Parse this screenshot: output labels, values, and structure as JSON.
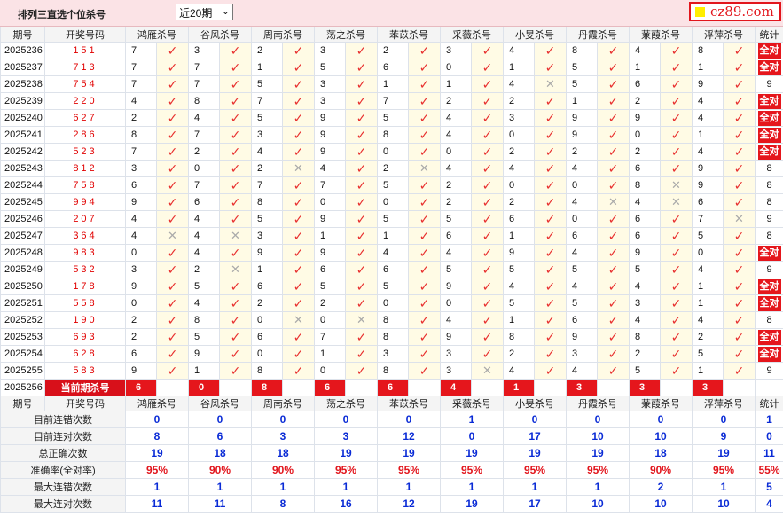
{
  "header": {
    "title": "排列三直选个位杀号",
    "period_select": "近20期",
    "logo_text": "cz89.com"
  },
  "columns": {
    "issue": "期号",
    "draw": "开奖号码",
    "stat": "统计",
    "predictors": [
      "鸿雁杀号",
      "谷风杀号",
      "周南杀号",
      "荡之杀号",
      "苯苡杀号",
      "采薇杀号",
      "小旻杀号",
      "丹霞杀号",
      "蒹葭杀号",
      "浮萍杀号"
    ]
  },
  "full_badge": "全对",
  "rows": [
    {
      "issue": "2025236",
      "draw": "151",
      "kills": [
        7,
        3,
        2,
        3,
        2,
        3,
        4,
        8,
        4,
        8
      ],
      "hits": [
        1,
        1,
        1,
        1,
        1,
        1,
        1,
        1,
        1,
        1
      ],
      "stat": "全对"
    },
    {
      "issue": "2025237",
      "draw": "713",
      "kills": [
        7,
        7,
        1,
        5,
        6,
        0,
        1,
        5,
        1,
        1
      ],
      "hits": [
        1,
        1,
        1,
        1,
        1,
        1,
        1,
        1,
        1,
        1
      ],
      "stat": "全对"
    },
    {
      "issue": "2025238",
      "draw": "754",
      "kills": [
        7,
        7,
        5,
        3,
        1,
        1,
        4,
        5,
        6,
        9
      ],
      "hits": [
        1,
        1,
        1,
        1,
        1,
        1,
        0,
        1,
        1,
        1
      ],
      "stat": "9"
    },
    {
      "issue": "2025239",
      "draw": "220",
      "kills": [
        4,
        8,
        7,
        3,
        7,
        2,
        2,
        1,
        2,
        4
      ],
      "hits": [
        1,
        1,
        1,
        1,
        1,
        1,
        1,
        1,
        1,
        1
      ],
      "stat": "全对"
    },
    {
      "issue": "2025240",
      "draw": "627",
      "kills": [
        2,
        4,
        5,
        9,
        5,
        4,
        3,
        9,
        9,
        4
      ],
      "hits": [
        1,
        1,
        1,
        1,
        1,
        1,
        1,
        1,
        1,
        1
      ],
      "stat": "全对"
    },
    {
      "issue": "2025241",
      "draw": "286",
      "kills": [
        8,
        7,
        3,
        9,
        8,
        4,
        0,
        9,
        0,
        1
      ],
      "hits": [
        1,
        1,
        1,
        1,
        1,
        1,
        1,
        1,
        1,
        1
      ],
      "stat": "全对"
    },
    {
      "issue": "2025242",
      "draw": "523",
      "kills": [
        7,
        2,
        4,
        9,
        0,
        0,
        2,
        2,
        2,
        4
      ],
      "hits": [
        1,
        1,
        1,
        1,
        1,
        1,
        1,
        1,
        1,
        1
      ],
      "stat": "全对"
    },
    {
      "issue": "2025243",
      "draw": "812",
      "kills": [
        3,
        0,
        2,
        4,
        2,
        4,
        4,
        4,
        6,
        9
      ],
      "hits": [
        1,
        1,
        0,
        1,
        0,
        1,
        1,
        1,
        1,
        1
      ],
      "stat": "8"
    },
    {
      "issue": "2025244",
      "draw": "758",
      "kills": [
        6,
        7,
        7,
        7,
        5,
        2,
        0,
        0,
        8,
        9
      ],
      "hits": [
        1,
        1,
        1,
        1,
        1,
        1,
        1,
        1,
        0,
        1
      ],
      "stat": "8"
    },
    {
      "issue": "2025245",
      "draw": "994",
      "kills": [
        9,
        6,
        8,
        0,
        0,
        2,
        2,
        4,
        4,
        6
      ],
      "hits": [
        1,
        1,
        1,
        1,
        1,
        1,
        1,
        0,
        0,
        1
      ],
      "stat": "8"
    },
    {
      "issue": "2025246",
      "draw": "207",
      "kills": [
        4,
        4,
        5,
        9,
        5,
        5,
        6,
        0,
        6,
        7
      ],
      "hits": [
        1,
        1,
        1,
        1,
        1,
        1,
        1,
        1,
        1,
        0
      ],
      "stat": "9"
    },
    {
      "issue": "2025247",
      "draw": "364",
      "kills": [
        4,
        4,
        3,
        1,
        1,
        6,
        1,
        6,
        6,
        5
      ],
      "hits": [
        0,
        0,
        1,
        1,
        1,
        1,
        1,
        1,
        1,
        1
      ],
      "stat": "8"
    },
    {
      "issue": "2025248",
      "draw": "983",
      "kills": [
        0,
        4,
        9,
        9,
        4,
        4,
        9,
        4,
        9,
        0
      ],
      "hits": [
        1,
        1,
        1,
        1,
        1,
        1,
        1,
        1,
        1,
        1
      ],
      "stat": "全对"
    },
    {
      "issue": "2025249",
      "draw": "532",
      "kills": [
        3,
        2,
        1,
        6,
        6,
        5,
        5,
        5,
        5,
        4
      ],
      "hits": [
        1,
        0,
        1,
        1,
        1,
        1,
        1,
        1,
        1,
        1
      ],
      "stat": "9"
    },
    {
      "issue": "2025250",
      "draw": "178",
      "kills": [
        9,
        5,
        6,
        5,
        5,
        9,
        4,
        4,
        4,
        1
      ],
      "hits": [
        1,
        1,
        1,
        1,
        1,
        1,
        1,
        1,
        1,
        1
      ],
      "stat": "全对"
    },
    {
      "issue": "2025251",
      "draw": "558",
      "kills": [
        0,
        4,
        2,
        2,
        0,
        0,
        5,
        5,
        3,
        1
      ],
      "hits": [
        1,
        1,
        1,
        1,
        1,
        1,
        1,
        1,
        1,
        1
      ],
      "stat": "全对"
    },
    {
      "issue": "2025252",
      "draw": "190",
      "kills": [
        2,
        8,
        0,
        0,
        8,
        4,
        1,
        6,
        4,
        4
      ],
      "hits": [
        1,
        1,
        0,
        0,
        1,
        1,
        1,
        1,
        1,
        1
      ],
      "stat": "8"
    },
    {
      "issue": "2025253",
      "draw": "693",
      "kills": [
        2,
        5,
        6,
        7,
        8,
        9,
        8,
        9,
        8,
        2
      ],
      "hits": [
        1,
        1,
        1,
        1,
        1,
        1,
        1,
        1,
        1,
        1
      ],
      "stat": "全对"
    },
    {
      "issue": "2025254",
      "draw": "628",
      "kills": [
        6,
        9,
        0,
        1,
        3,
        3,
        2,
        3,
        2,
        5
      ],
      "hits": [
        1,
        1,
        1,
        1,
        1,
        1,
        1,
        1,
        1,
        1
      ],
      "stat": "全对"
    },
    {
      "issue": "2025255",
      "draw": "583",
      "kills": [
        9,
        1,
        8,
        0,
        8,
        3,
        4,
        4,
        5,
        1
      ],
      "hits": [
        1,
        1,
        1,
        1,
        1,
        0,
        1,
        1,
        1,
        1
      ],
      "stat": "9"
    }
  ],
  "current": {
    "issue": "2025256",
    "label": "当前期杀号",
    "kills": [
      6,
      0,
      8,
      6,
      6,
      4,
      1,
      3,
      3,
      3
    ]
  },
  "stats": [
    {
      "label": "目前连错次数",
      "values": [
        "0",
        "0",
        "0",
        "0",
        "0",
        "1",
        "0",
        "0",
        "0",
        "0",
        "1"
      ],
      "red": false
    },
    {
      "label": "目前连对次数",
      "values": [
        "8",
        "6",
        "3",
        "3",
        "12",
        "0",
        "17",
        "10",
        "10",
        "9",
        "0"
      ],
      "red": false
    },
    {
      "label": "总正确次数",
      "values": [
        "19",
        "18",
        "18",
        "19",
        "19",
        "19",
        "19",
        "19",
        "18",
        "19",
        "11"
      ],
      "red": false
    },
    {
      "label": "准确率(全对率)",
      "values": [
        "95%",
        "90%",
        "90%",
        "95%",
        "95%",
        "95%",
        "95%",
        "95%",
        "90%",
        "95%",
        "55%"
      ],
      "red": true
    },
    {
      "label": "最大连错次数",
      "values": [
        "1",
        "1",
        "1",
        "1",
        "1",
        "1",
        "1",
        "1",
        "2",
        "1",
        "5"
      ],
      "red": false
    },
    {
      "label": "最大连对次数",
      "values": [
        "11",
        "11",
        "8",
        "16",
        "12",
        "19",
        "17",
        "10",
        "10",
        "10",
        "4"
      ],
      "red": false
    }
  ],
  "icons": {
    "hit": "check-icon",
    "miss": "cross-icon"
  },
  "colors": {
    "hit": "#e8302f",
    "miss": "#aaaaaa",
    "badge": "#e5161c",
    "stat_value": "#0a2bd6"
  }
}
